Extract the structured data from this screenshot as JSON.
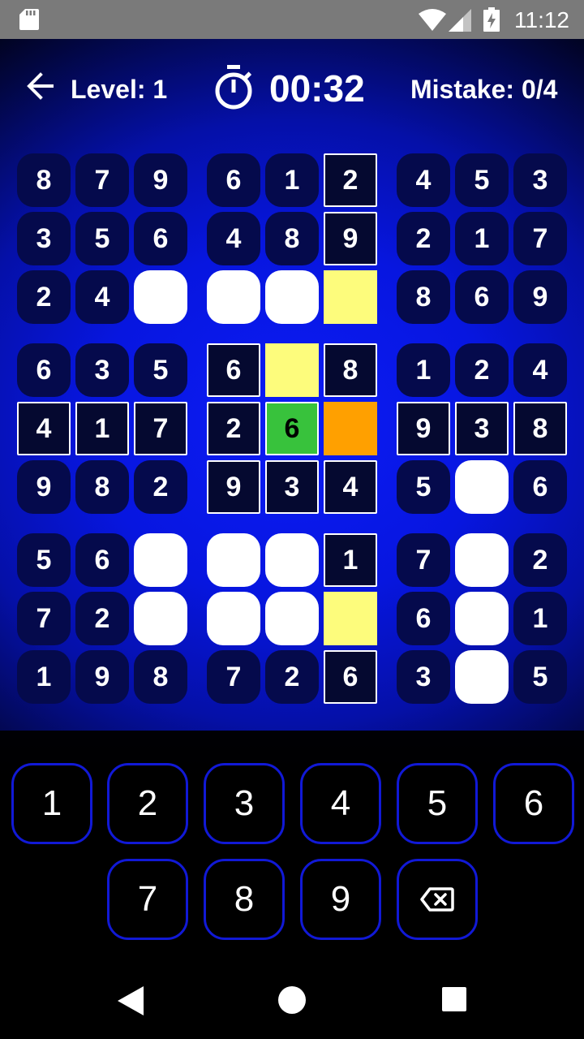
{
  "status_bar": {
    "time": "11:12",
    "icons": [
      "sd-card-icon",
      "wifi-icon",
      "cell-signal-icon",
      "battery-charging-icon"
    ]
  },
  "header": {
    "level_label": "Level: 1",
    "timer": "00:32",
    "mistakes": "Mistake: 0/4"
  },
  "board": {
    "rows": [
      [
        "8",
        "7",
        "9",
        "6",
        "1",
        "2",
        "4",
        "5",
        "3"
      ],
      [
        "3",
        "5",
        "6",
        "4",
        "8",
        "9",
        "2",
        "1",
        "7"
      ],
      [
        "2",
        "4",
        "",
        "",
        "",
        "",
        "8",
        "6",
        "9"
      ],
      [
        "6",
        "3",
        "5",
        "6",
        "",
        "8",
        "1",
        "2",
        "4"
      ],
      [
        "4",
        "1",
        "7",
        "2",
        "6",
        "",
        "9",
        "3",
        "8"
      ],
      [
        "9",
        "8",
        "2",
        "9",
        "3",
        "4",
        "5",
        "",
        "6"
      ],
      [
        "5",
        "6",
        "",
        "",
        "",
        "1",
        "7",
        "",
        "2"
      ],
      [
        "7",
        "2",
        "",
        "",
        "",
        "",
        "6",
        "",
        "1"
      ],
      [
        "1",
        "9",
        "8",
        "7",
        "2",
        "6",
        "3",
        "",
        "5"
      ]
    ],
    "selected_cell": {
      "row": 4,
      "col": 5
    },
    "colors": {
      "cell": "#050a4c",
      "empty": "#ffffff",
      "highlight": "#050930",
      "selected": "#ffa000",
      "peer_empty": "#fdfc7c",
      "match": "#38c23c"
    }
  },
  "keypad": {
    "keys": [
      "1",
      "2",
      "3",
      "4",
      "5",
      "6",
      "7",
      "8",
      "9"
    ],
    "erase_icon": "backspace-icon"
  },
  "nav_bar": {
    "icons": [
      "nav-back-icon",
      "nav-home-icon",
      "nav-recent-apps-icon"
    ]
  }
}
